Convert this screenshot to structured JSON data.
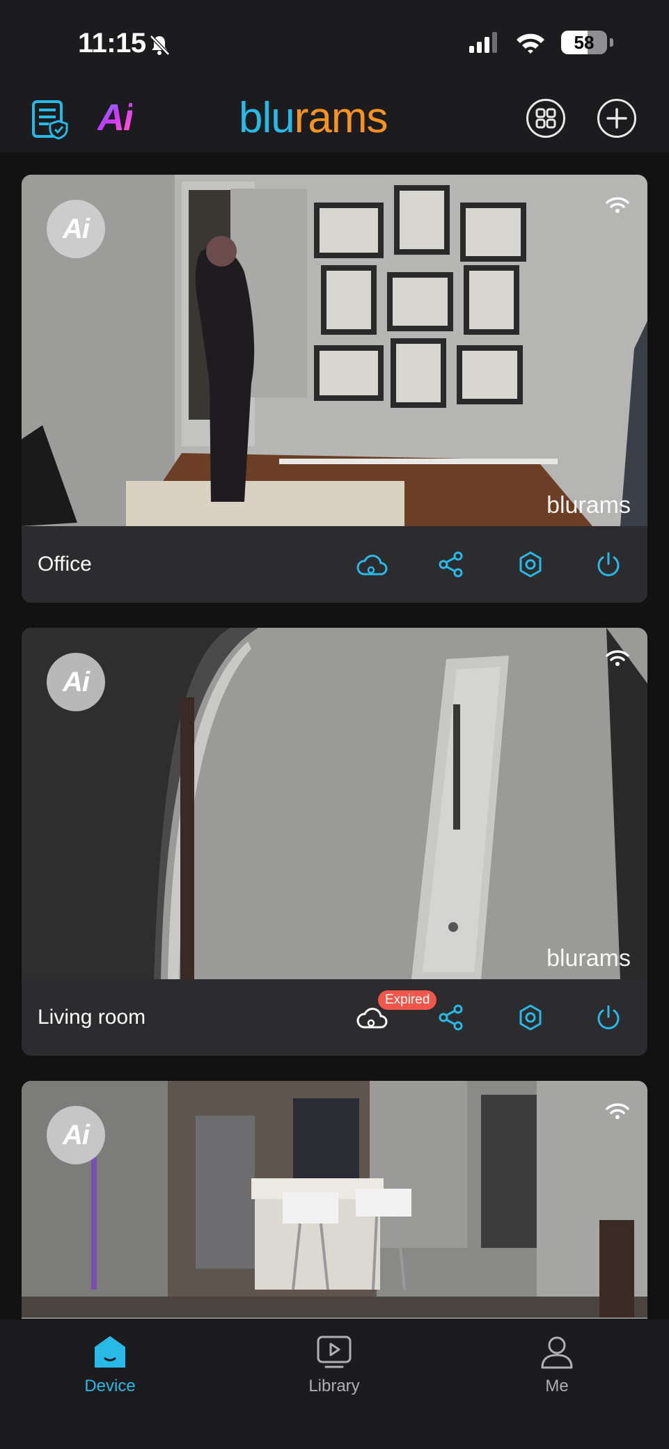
{
  "status_bar": {
    "time": "11:15",
    "battery": "58",
    "battery_level": 0.58
  },
  "header": {
    "ai_label": "Ai",
    "logo_part1": "blu",
    "logo_part2": "rams"
  },
  "cameras": [
    {
      "name": "Office",
      "ai_badge": "Ai",
      "watermark": "blurams",
      "cloud_status": ""
    },
    {
      "name": "Living room",
      "ai_badge": "Ai",
      "watermark": "blurams",
      "cloud_status": "Expired"
    },
    {
      "name": "",
      "ai_badge": "Ai",
      "watermark": "",
      "cloud_status": ""
    }
  ],
  "tabs": [
    {
      "label": "Device",
      "active": true
    },
    {
      "label": "Library",
      "active": false
    },
    {
      "label": "Me",
      "active": false
    }
  ],
  "colors": {
    "accent": "#28b9e6",
    "brand_orange": "#f7931e",
    "expired_badge": "#f0564a",
    "background": "#1c1c1e",
    "card": "#2c2c2e"
  }
}
